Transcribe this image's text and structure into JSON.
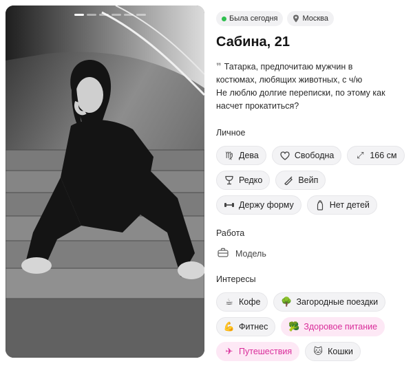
{
  "photo": {
    "alt": "Profile photo",
    "pages": 6,
    "active_page": 1
  },
  "status": {
    "online_label": "Была сегодня",
    "online_color": "#2fbf4f",
    "location_icon": "location-pin-icon",
    "location_label": "Москва"
  },
  "profile": {
    "name": "Сабина, 21",
    "quote_icon": "quote-icon",
    "bio_lines": [
      "Татарка, предпочитаю мужчин в",
      "костюмах, любящих животных, с ч/ю",
      "Не люблю долгие переписки, по этому как",
      "насчет прокатиться?"
    ]
  },
  "personal": {
    "title": "Личное",
    "chips": [
      {
        "icon": "virgo-icon",
        "label": "Дева"
      },
      {
        "icon": "heart-icon",
        "label": "Свободна"
      },
      {
        "icon": "height-arrows-icon",
        "label": "166 см"
      },
      {
        "icon": "wine-glass-icon",
        "label": "Редко"
      },
      {
        "icon": "vape-icon",
        "label": "Вейп"
      },
      {
        "icon": "dumbbell-icon",
        "label": "Держу форму"
      },
      {
        "icon": "baby-bottle-icon",
        "label": "Нет детей"
      }
    ]
  },
  "work": {
    "title": "Работа",
    "icon": "briefcase-icon",
    "value": "Модель"
  },
  "interests": {
    "title": "Интересы",
    "accent_color": "#d92d9a",
    "chips": [
      {
        "icon": "coffee-icon",
        "emoji": "☕",
        "label": "Кофе",
        "highlighted": false
      },
      {
        "icon": "tree-icon",
        "emoji": "🌳",
        "label": "Загородные поездки",
        "highlighted": false
      },
      {
        "icon": "flexed-biceps-icon",
        "emoji": "💪",
        "label": "Фитнес",
        "highlighted": false
      },
      {
        "icon": "broccoli-icon",
        "emoji": "🥦",
        "label": "Здоровое питание",
        "highlighted": true
      },
      {
        "icon": "airplane-icon",
        "emoji": "✈",
        "label": "Путешествия",
        "highlighted": true
      },
      {
        "icon": "cat-icon",
        "emoji": "🐱",
        "label": "Кошки",
        "highlighted": false
      }
    ]
  }
}
